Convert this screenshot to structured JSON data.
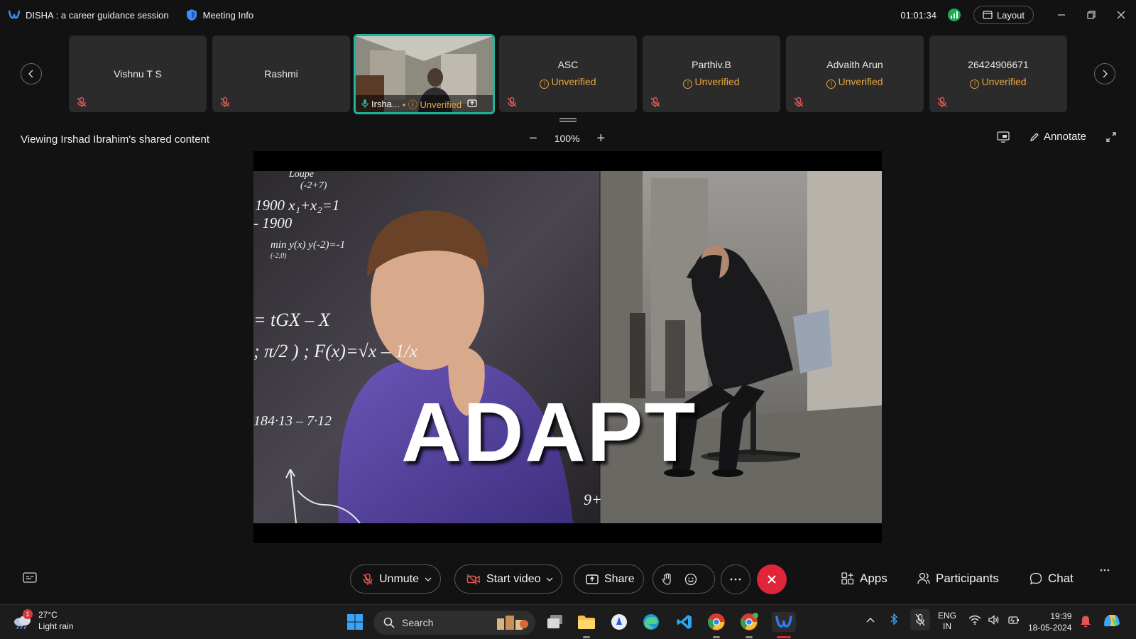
{
  "titlebar": {
    "meeting_title": "DISHA : a career guidance session",
    "meeting_info_label": "Meeting Info",
    "timer": "01:01:34",
    "layout_label": "Layout"
  },
  "participants": [
    {
      "name": "Vishnu  T S",
      "status": ""
    },
    {
      "name": "Rashmi",
      "status": ""
    },
    {
      "name": "Irsha...",
      "status": "Unverified",
      "active": true
    },
    {
      "name": "ASC",
      "status": "Unverified"
    },
    {
      "name": "Parthiv.B",
      "status": "Unverified"
    },
    {
      "name": "Advaith Arun",
      "status": "Unverified"
    },
    {
      "name": "26424906671",
      "status": "Unverified"
    }
  ],
  "viewbar": {
    "viewing_text": "Viewing Irshad Ibrahim's shared content",
    "zoom_level": "100%",
    "annotate_label": "Annotate"
  },
  "shared_content": {
    "headline": "ADAPT",
    "board_lines": [
      "Loupe",
      "(-2+7)",
      "1900  x₁+x₂=1",
      "- 1900",
      "min  y(x) y(-2)=-1",
      "(-2,0)",
      "= tGX – X",
      "; π/2 ) ; F(x)=√x – 1/x",
      "184·13 – 7·12",
      "9+"
    ]
  },
  "controls": {
    "unmute_label": "Unmute",
    "start_video_label": "Start video",
    "share_label": "Share",
    "apps_label": "Apps",
    "participants_label": "Participants",
    "chat_label": "Chat"
  },
  "taskbar": {
    "temperature": "27°C",
    "weather_desc": "Light rain",
    "weather_badge": "1",
    "search_placeholder": "Search",
    "language_line1": "ENG",
    "language_line2": "IN",
    "time": "19:39",
    "date": "18-05-2024"
  },
  "colors": {
    "active_border": "#1fb59e",
    "unverified": "#e8a640",
    "end_call": "#e0243a",
    "mic_off": "#e05555"
  }
}
